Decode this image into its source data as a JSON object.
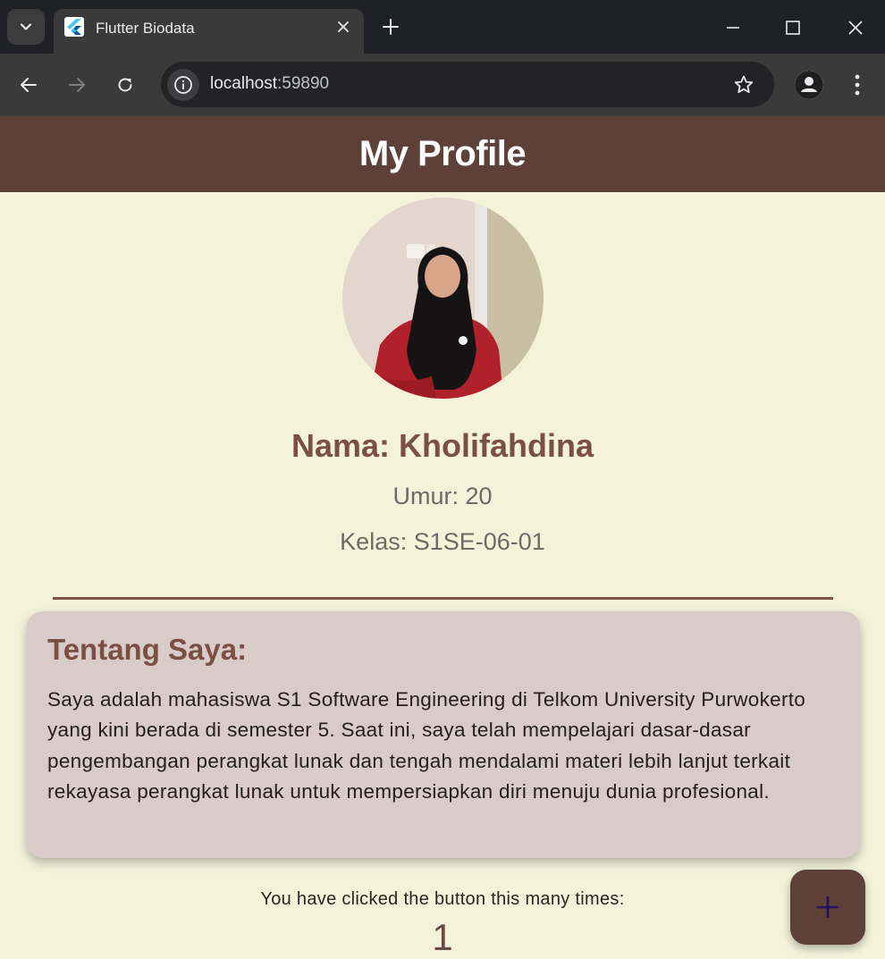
{
  "browser": {
    "tab": {
      "title": "Flutter Biodata",
      "favicon": "flutter-icon"
    },
    "address_bar": {
      "host": "localhost",
      "port": ":59890"
    },
    "icons": {
      "tab_search": "chevron-down-icon",
      "close_tab": "close-icon",
      "new_tab": "plus-icon",
      "minimize": "minimize-icon",
      "maximize": "maximize-icon",
      "close_window": "close-icon",
      "back": "arrow-left-icon",
      "forward": "arrow-right-icon",
      "reload": "reload-icon",
      "site_info": "info-icon",
      "bookmark": "star-icon",
      "profile": "person-icon",
      "menu": "more-vertical-icon"
    }
  },
  "app": {
    "title": "My Profile",
    "profile": {
      "name": "Nama: Kholifahdina",
      "age": "Umur: 20",
      "class": "Kelas: S1SE-06-01"
    },
    "about": {
      "title": "Tentang Saya:",
      "body": "Saya adalah mahasiswa S1 Software Engineering di Telkom University Purwokerto yang kini berada di semester 5. Saat ini, saya telah mempelajari dasar-dasar pengembangan perangkat lunak dan tengah mendalami materi lebih lanjut terkait rekayasa perangkat lunak untuk mempersiapkan diri menuju dunia profesional."
    },
    "counter": {
      "label": "You have clicked the button this many times:",
      "value": "1"
    },
    "fab_icon": "plus-icon"
  },
  "colors": {
    "appbar": "#5d4038",
    "background": "#f4f3da",
    "accent_text": "#7a4f44",
    "card": "#d8cbc8",
    "fab_icon": "#2a0f5f"
  }
}
